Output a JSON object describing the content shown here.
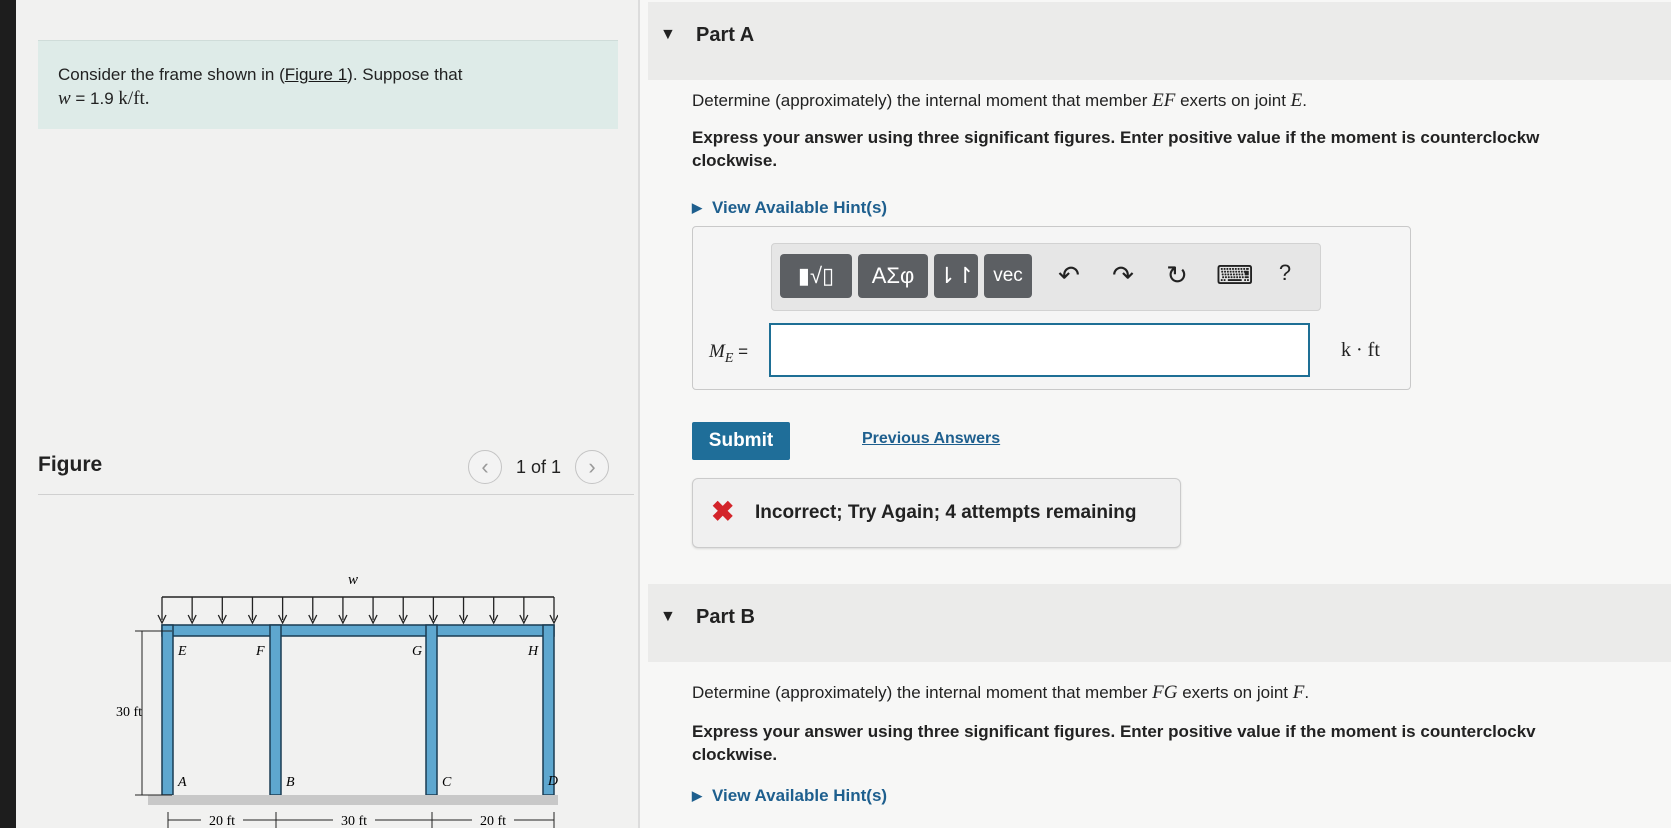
{
  "problem": {
    "text_before": "Consider the frame shown in (",
    "figure_link": "Figure 1",
    "text_after": "). Suppose that",
    "w_symbol": "w",
    "w_value": " = 1.9 ",
    "w_unit": "k/ft."
  },
  "figure": {
    "label": "Figure",
    "page_indicator": "1 of 1",
    "load_label": "w",
    "height_label": "30 ft",
    "joints": [
      "E",
      "F",
      "G",
      "H",
      "A",
      "B",
      "C",
      "D"
    ],
    "spans": [
      "20 ft",
      "30 ft",
      "20 ft"
    ]
  },
  "part_a": {
    "title": "Part A",
    "q_pre": "Determine (approximately) the internal moment that member ",
    "q_member": "EF",
    "q_mid": " exerts on joint ",
    "q_joint": "E",
    "q_end": ".",
    "instructions_line1": "Express your answer using three significant figures. Enter positive value if the moment is counterclockw",
    "instructions_line2": "clockwise.",
    "hints": "View Available Hint(s)",
    "answer_label": "M",
    "answer_sub": "E",
    "answer_eq": " =",
    "answer_unit": "k · ft",
    "toolbar": {
      "templates": "▮√▯",
      "greek": "ΑΣφ",
      "updown": "⇂↾",
      "vec": "vec",
      "undo": "↶",
      "redo": "↷",
      "reset": "↻",
      "keyboard": "⌨",
      "help": "?"
    },
    "submit": "Submit",
    "previous": "Previous Answers",
    "feedback_icon": "✖",
    "feedback": "Incorrect; Try Again; 4 attempts remaining"
  },
  "part_b": {
    "title": "Part B",
    "q_pre": "Determine (approximately) the internal moment that member ",
    "q_member": "FG",
    "q_mid": " exerts on joint ",
    "q_joint": "F",
    "q_end": ".",
    "instructions_line1": "Express your answer using three significant figures. Enter positive value if the moment is counterclockv",
    "instructions_line2": "clockwise.",
    "hints": "View Available Hint(s)"
  },
  "icons": {
    "collapse": "triangle-down-icon",
    "hint": "triangle-right-icon",
    "prev": "chevron-left-icon",
    "next": "chevron-right-icon"
  },
  "colors": {
    "link": "#1e5f8e",
    "submit": "#1f6e99",
    "error": "#d3242a",
    "frame_blue": "#5ea7cf"
  }
}
